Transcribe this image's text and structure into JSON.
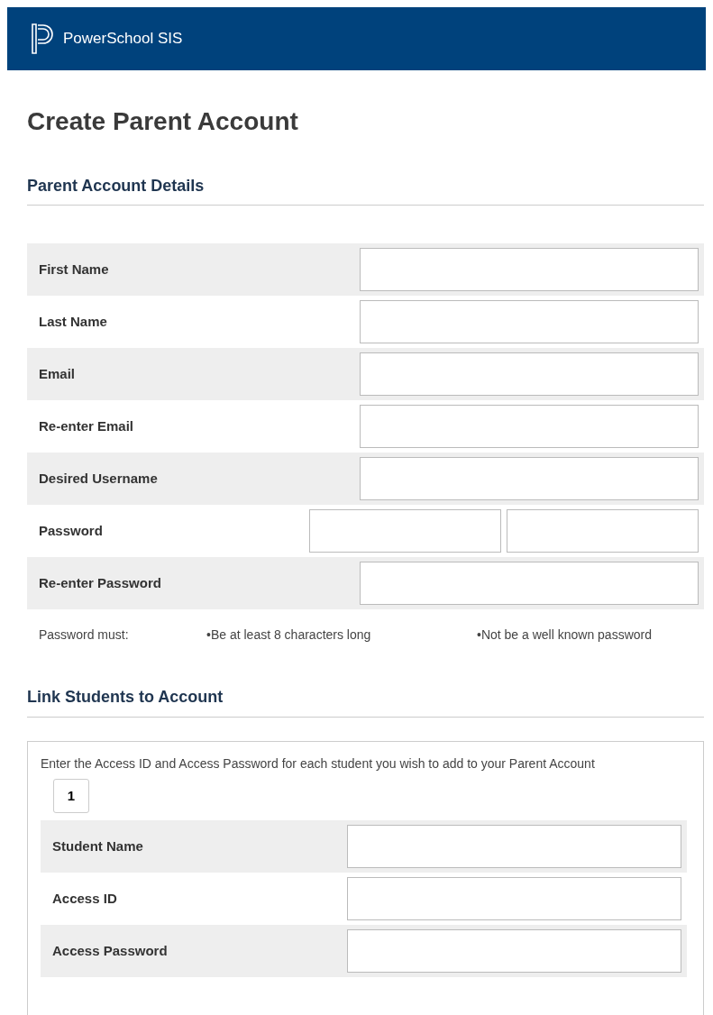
{
  "header": {
    "title": "PowerSchool SIS"
  },
  "page_title": "Create Parent Account",
  "parent_section": {
    "heading": "Parent Account Details",
    "fields": [
      {
        "label": "First Name",
        "kind": "single"
      },
      {
        "label": "Last Name",
        "kind": "single"
      },
      {
        "label": "Email",
        "kind": "single"
      },
      {
        "label": "Re-enter Email",
        "kind": "single"
      },
      {
        "label": "Desired Username",
        "kind": "single"
      },
      {
        "label": "Password",
        "kind": "split"
      },
      {
        "label": "Re-enter Password",
        "kind": "single"
      }
    ],
    "password_rules": {
      "label": "Password must:",
      "rules": [
        "•Be at least 8 characters long",
        "•Not be a well known password"
      ]
    }
  },
  "students_section": {
    "heading": "Link Students to Account",
    "instructions": "Enter the Access ID and Access Password for each student you wish to add to your Parent Account",
    "student_number": "1",
    "fields": [
      {
        "label": "Student Name",
        "kind": "single"
      },
      {
        "label": "Access ID",
        "kind": "single"
      },
      {
        "label": "Access Password",
        "kind": "single"
      }
    ]
  }
}
